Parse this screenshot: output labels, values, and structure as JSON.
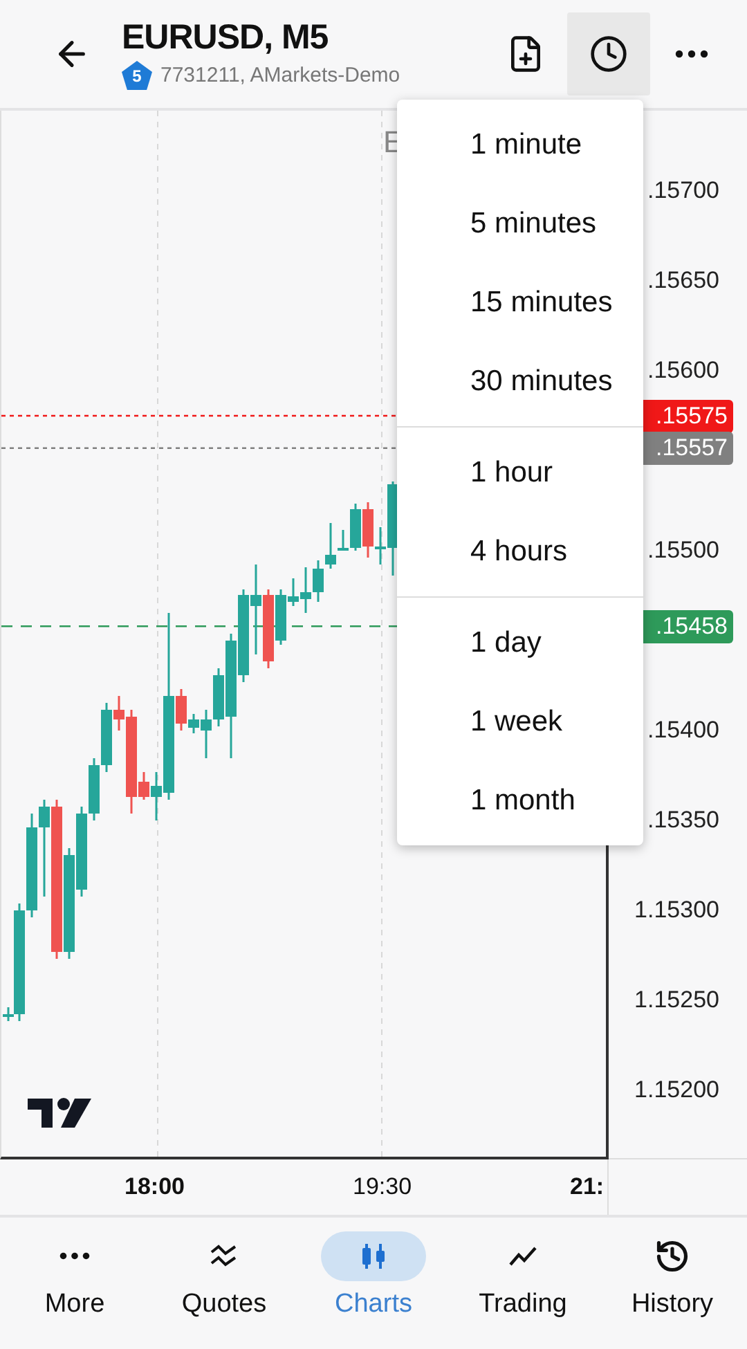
{
  "header": {
    "title": "EURUSD, M5",
    "badge": "5",
    "account": "7731211, AMarkets-Demo",
    "actions": [
      {
        "kind": "add-file",
        "selected": false
      },
      {
        "kind": "clock",
        "selected": true
      },
      {
        "kind": "more",
        "selected": false
      }
    ]
  },
  "chart": {
    "title_fragment": "E",
    "price_labels": [
      {
        "text": ".15700"
      },
      {
        "text": ".15650"
      },
      {
        "text": ".15600"
      },
      {
        "text": ".15500"
      },
      {
        "text": ".15400"
      },
      {
        "text": ".15350"
      },
      {
        "text": "1.15300"
      },
      {
        "text": "1.15250"
      },
      {
        "text": "1.15200"
      }
    ],
    "price_badges": [
      {
        "text": ".15575",
        "color": "#f01818"
      },
      {
        "text": ".15557",
        "color": "#808080"
      },
      {
        "text": ".15458",
        "color": "#2e9a5a"
      }
    ],
    "time_labels": [
      {
        "text": "18:00",
        "kind": "major"
      },
      {
        "text": "19:30",
        "kind": "minor"
      },
      {
        "text": "21:",
        "kind": "major"
      }
    ]
  },
  "menu": {
    "groups": [
      {
        "items": [
          {
            "label": "1 minute"
          },
          {
            "label": "5 minutes"
          },
          {
            "label": "15 minutes"
          },
          {
            "label": "30 minutes"
          }
        ]
      },
      {
        "items": [
          {
            "label": "1 hour"
          },
          {
            "label": "4 hours"
          }
        ]
      },
      {
        "items": [
          {
            "label": "1 day"
          },
          {
            "label": "1 week"
          },
          {
            "label": "1 month"
          }
        ]
      }
    ]
  },
  "nav": [
    {
      "kind": "more",
      "label": "More",
      "selected": false
    },
    {
      "kind": "quotes",
      "label": "Quotes",
      "selected": false
    },
    {
      "kind": "charts",
      "label": "Charts",
      "selected": true
    },
    {
      "kind": "trading",
      "label": "Trading",
      "selected": false
    },
    {
      "kind": "history",
      "label": "History",
      "selected": false
    }
  ]
}
